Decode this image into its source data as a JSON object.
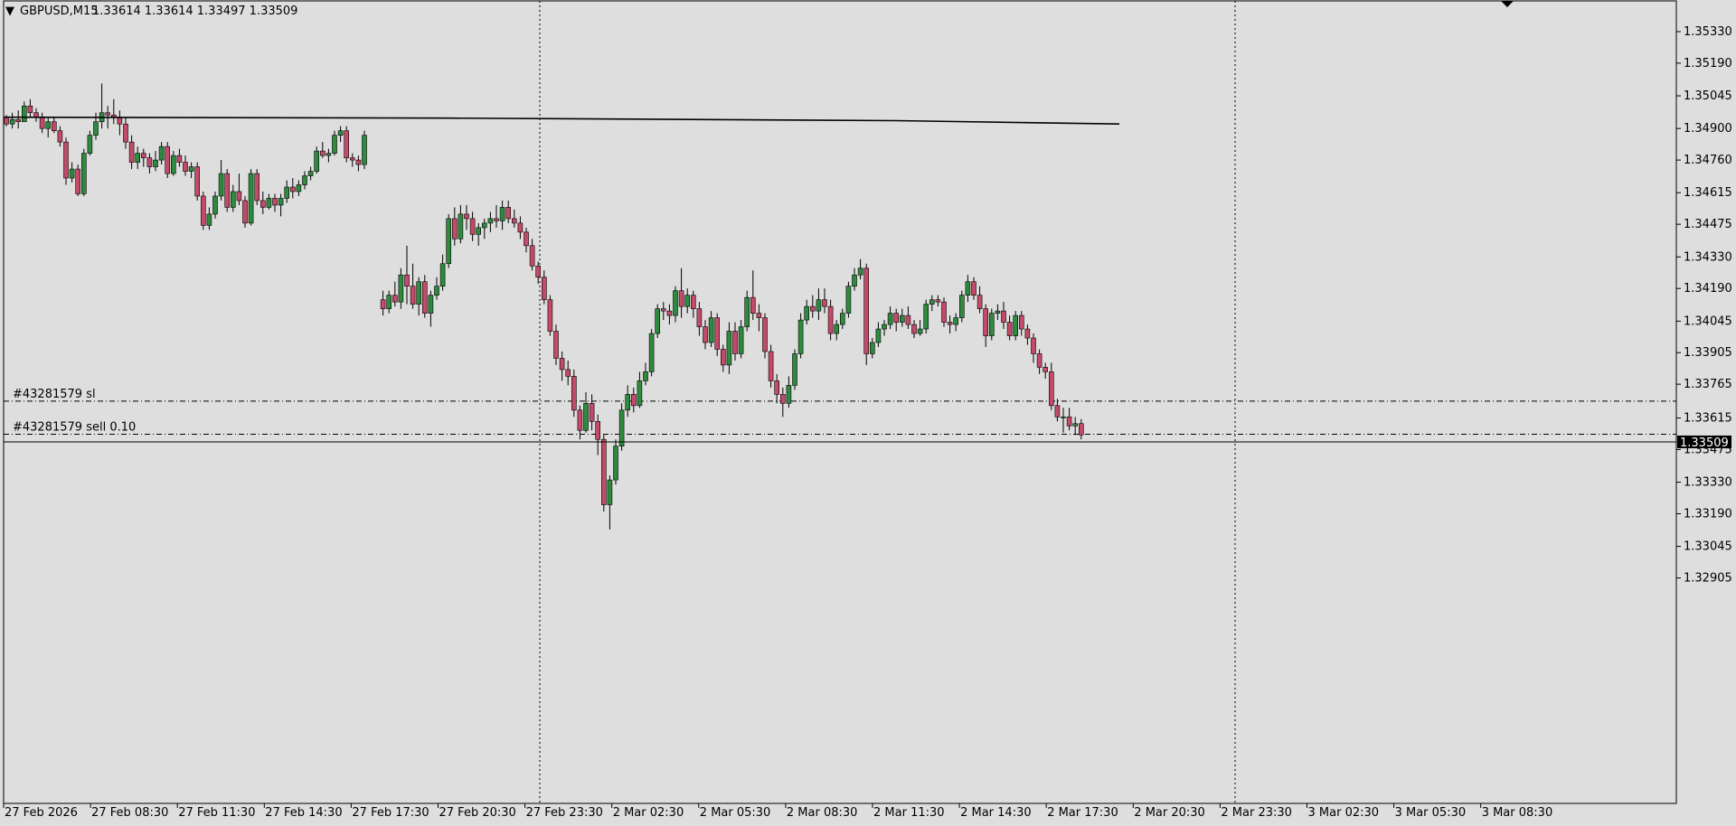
{
  "header": {
    "triangle": "▼",
    "symbol": "GBPUSD,M15",
    "ohlc": "1.33614 1.33614 1.33497 1.33509"
  },
  "price_tag": "1.33509",
  "colors": {
    "background": "#dedede",
    "bull": "#2e8b3e",
    "bear": "#c44a6a",
    "wick": "#000000",
    "price_tag_bg": "#000000",
    "price_tag_text": "#ffffff"
  },
  "order_lines": {
    "sl_label": "#43281579 sl",
    "sl_price": 1.3369,
    "sell_label": "#43281579 sell 0.10",
    "sell_price": 1.33543
  },
  "chart_data": {
    "type": "candlestick",
    "title": "GBPUSD,M15",
    "y_axis_position": "right",
    "ylim": [
      1.3286,
      1.3545
    ],
    "y_ticks": [
      "1.35330",
      "1.35190",
      "1.35045",
      "1.34900",
      "1.34760",
      "1.34615",
      "1.34475",
      "1.34330",
      "1.34190",
      "1.34045",
      "1.33905",
      "1.33765",
      "1.33615",
      "1.33475",
      "1.33330",
      "1.33190",
      "1.33045",
      "1.32905"
    ],
    "x_ticks": [
      "27 Feb 2026",
      "27 Feb 08:30",
      "27 Feb 11:30",
      "27 Feb 14:30",
      "27 Feb 17:30",
      "27 Feb 20:30",
      "27 Feb 23:30",
      "2 Mar 02:30",
      "2 Mar 05:30",
      "2 Mar 08:30",
      "2 Mar 11:30",
      "2 Mar 14:30",
      "2 Mar 17:30",
      "2 Mar 20:30",
      "2 Mar 23:30",
      "3 Mar 02:30",
      "3 Mar 05:30",
      "3 Mar 08:30"
    ],
    "grid": false,
    "period_separators": [
      "27 Feb 23:30",
      "2 Mar 23:30"
    ],
    "current_price": 1.33509,
    "moving_average": [
      {
        "x": 0,
        "y": 1.3495
      },
      {
        "x": 80,
        "y": 1.34946
      },
      {
        "x": 160,
        "y": 1.34935
      },
      {
        "x": 200,
        "y": 1.3492
      }
    ],
    "candles": [
      [
        1.3495,
        1.3496,
        1.3491,
        1.3492
      ],
      [
        1.3492,
        1.3497,
        1.349,
        1.3494
      ],
      [
        1.3494,
        1.3498,
        1.349,
        1.3493
      ],
      [
        1.3493,
        1.3502,
        1.3493,
        1.35
      ],
      [
        1.35,
        1.3503,
        1.3495,
        1.3497
      ],
      [
        1.3497,
        1.3499,
        1.3493,
        1.3495
      ],
      [
        1.3495,
        1.3497,
        1.3488,
        1.349
      ],
      [
        1.349,
        1.3495,
        1.3486,
        1.3493
      ],
      [
        1.3493,
        1.3495,
        1.3488,
        1.3489
      ],
      [
        1.3489,
        1.3491,
        1.3482,
        1.3484
      ],
      [
        1.3484,
        1.3486,
        1.3465,
        1.3468
      ],
      [
        1.3468,
        1.3475,
        1.3466,
        1.3472
      ],
      [
        1.3472,
        1.3474,
        1.346,
        1.3461
      ],
      [
        1.3461,
        1.3481,
        1.346,
        1.3479
      ],
      [
        1.3479,
        1.3489,
        1.3478,
        1.3487
      ],
      [
        1.3487,
        1.3497,
        1.3485,
        1.3493
      ],
      [
        1.3493,
        1.351,
        1.349,
        1.3497
      ],
      [
        1.3497,
        1.35,
        1.349,
        1.3496
      ],
      [
        1.3496,
        1.3503,
        1.3492,
        1.3495
      ],
      [
        1.3495,
        1.3498,
        1.3487,
        1.3492
      ],
      [
        1.3492,
        1.3495,
        1.3481,
        1.3484
      ],
      [
        1.3484,
        1.3487,
        1.3472,
        1.3475
      ],
      [
        1.3475,
        1.3482,
        1.3472,
        1.3479
      ],
      [
        1.3479,
        1.3481,
        1.3473,
        1.3477
      ],
      [
        1.3477,
        1.3479,
        1.347,
        1.3473
      ],
      [
        1.3473,
        1.348,
        1.3471,
        1.3476
      ],
      [
        1.3476,
        1.3484,
        1.3474,
        1.3482
      ],
      [
        1.3482,
        1.3484,
        1.3468,
        1.347
      ],
      [
        1.347,
        1.348,
        1.3469,
        1.3478
      ],
      [
        1.3478,
        1.3481,
        1.3473,
        1.3475
      ],
      [
        1.3475,
        1.3478,
        1.3469,
        1.3471
      ],
      [
        1.3471,
        1.3475,
        1.3468,
        1.3473
      ],
      [
        1.3473,
        1.3475,
        1.3458,
        1.346
      ],
      [
        1.346,
        1.3462,
        1.3445,
        1.3447
      ],
      [
        1.3447,
        1.3455,
        1.3445,
        1.3452
      ],
      [
        1.3452,
        1.3462,
        1.345,
        1.346
      ],
      [
        1.346,
        1.3476,
        1.3458,
        1.347
      ],
      [
        1.347,
        1.3472,
        1.3453,
        1.3455
      ],
      [
        1.3455,
        1.3465,
        1.3453,
        1.3462
      ],
      [
        1.3462,
        1.347,
        1.3456,
        1.3458
      ],
      [
        1.3458,
        1.346,
        1.3446,
        1.3448
      ],
      [
        1.3448,
        1.3472,
        1.3447,
        1.347
      ],
      [
        1.347,
        1.3472,
        1.3456,
        1.3458
      ],
      [
        1.3458,
        1.3462,
        1.3452,
        1.3455
      ],
      [
        1.3455,
        1.3461,
        1.3454,
        1.3459
      ],
      [
        1.3459,
        1.3461,
        1.3453,
        1.3456
      ],
      [
        1.3456,
        1.3461,
        1.3451,
        1.3459
      ],
      [
        1.3459,
        1.3467,
        1.3457,
        1.3464
      ],
      [
        1.3464,
        1.3468,
        1.3459,
        1.3462
      ],
      [
        1.3462,
        1.3467,
        1.346,
        1.3465
      ],
      [
        1.3465,
        1.3471,
        1.3463,
        1.3469
      ],
      [
        1.3469,
        1.3473,
        1.3467,
        1.3471
      ],
      [
        1.3471,
        1.3482,
        1.347,
        1.348
      ],
      [
        1.348,
        1.3484,
        1.3477,
        1.3478
      ],
      [
        1.3478,
        1.3481,
        1.3475,
        1.3479
      ],
      [
        1.3479,
        1.3489,
        1.3478,
        1.3487
      ],
      [
        1.3487,
        1.3491,
        1.3484,
        1.3489
      ],
      [
        1.3489,
        1.3491,
        1.3475,
        1.3477
      ],
      [
        1.3477,
        1.3479,
        1.3473,
        1.3476
      ],
      [
        1.3476,
        1.3478,
        1.3471,
        1.3474
      ],
      [
        1.3474,
        1.3489,
        1.3472,
        1.3487
      ],
      [
        1.3414,
        1.3418,
        1.3407,
        1.341
      ],
      [
        1.341,
        1.3418,
        1.3408,
        1.3416
      ],
      [
        1.3416,
        1.3422,
        1.3411,
        1.3413
      ],
      [
        1.3413,
        1.3428,
        1.341,
        1.3425
      ],
      [
        1.3425,
        1.3438,
        1.3412,
        1.342
      ],
      [
        1.342,
        1.343,
        1.341,
        1.3412
      ],
      [
        1.3412,
        1.3424,
        1.3407,
        1.3422
      ],
      [
        1.3422,
        1.3425,
        1.3406,
        1.3408
      ],
      [
        1.3408,
        1.3418,
        1.3402,
        1.3416
      ],
      [
        1.3416,
        1.3424,
        1.3414,
        1.342
      ],
      [
        1.342,
        1.3434,
        1.3418,
        1.343
      ],
      [
        1.343,
        1.3452,
        1.3428,
        1.345
      ],
      [
        1.345,
        1.3455,
        1.3438,
        1.3441
      ],
      [
        1.3441,
        1.3456,
        1.3439,
        1.3452
      ],
      [
        1.3452,
        1.3456,
        1.3445,
        1.345
      ],
      [
        1.345,
        1.3453,
        1.344,
        1.3443
      ],
      [
        1.3443,
        1.3448,
        1.3438,
        1.3446
      ],
      [
        1.3446,
        1.345,
        1.3441,
        1.3448
      ],
      [
        1.3448,
        1.3453,
        1.3444,
        1.345
      ],
      [
        1.345,
        1.3456,
        1.3446,
        1.3449
      ],
      [
        1.3449,
        1.3458,
        1.3445,
        1.3455
      ],
      [
        1.3455,
        1.3458,
        1.3448,
        1.345
      ],
      [
        1.345,
        1.3454,
        1.3446,
        1.3448
      ],
      [
        1.3448,
        1.3451,
        1.3441,
        1.3444
      ],
      [
        1.3444,
        1.3446,
        1.3435,
        1.3438
      ],
      [
        1.3438,
        1.3441,
        1.3427,
        1.3429
      ],
      [
        1.3429,
        1.3431,
        1.3421,
        1.3424
      ],
      [
        1.3424,
        1.3427,
        1.3412,
        1.3414
      ],
      [
        1.3414,
        1.3416,
        1.3398,
        1.34
      ],
      [
        1.34,
        1.3403,
        1.3385,
        1.3388
      ],
      [
        1.3388,
        1.3391,
        1.3378,
        1.3383
      ],
      [
        1.3383,
        1.3387,
        1.3376,
        1.338
      ],
      [
        1.338,
        1.3383,
        1.3362,
        1.3365
      ],
      [
        1.3365,
        1.3367,
        1.3352,
        1.3356
      ],
      [
        1.3356,
        1.3373,
        1.3355,
        1.3368
      ],
      [
        1.3368,
        1.3372,
        1.3356,
        1.336
      ],
      [
        1.336,
        1.3363,
        1.3345,
        1.3352
      ],
      [
        1.3352,
        1.3354,
        1.332,
        1.3323
      ],
      [
        1.3323,
        1.3336,
        1.3312,
        1.3334
      ],
      [
        1.3334,
        1.3352,
        1.3332,
        1.3349
      ],
      [
        1.3349,
        1.3368,
        1.3347,
        1.3365
      ],
      [
        1.3365,
        1.3376,
        1.3362,
        1.3372
      ],
      [
        1.3372,
        1.3375,
        1.3364,
        1.3367
      ],
      [
        1.3367,
        1.3382,
        1.3366,
        1.3378
      ],
      [
        1.3378,
        1.3386,
        1.3376,
        1.3382
      ],
      [
        1.3382,
        1.3401,
        1.338,
        1.3399
      ],
      [
        1.3399,
        1.3412,
        1.3397,
        1.341
      ],
      [
        1.341,
        1.3413,
        1.3405,
        1.3409
      ],
      [
        1.3409,
        1.3412,
        1.3403,
        1.3407
      ],
      [
        1.3407,
        1.342,
        1.3404,
        1.3418
      ],
      [
        1.3418,
        1.3428,
        1.3406,
        1.3411
      ],
      [
        1.3411,
        1.3419,
        1.3408,
        1.3416
      ],
      [
        1.3416,
        1.3418,
        1.3406,
        1.341
      ],
      [
        1.341,
        1.3413,
        1.3398,
        1.3402
      ],
      [
        1.3402,
        1.3405,
        1.3392,
        1.3395
      ],
      [
        1.3395,
        1.3409,
        1.3393,
        1.3406
      ],
      [
        1.3406,
        1.3408,
        1.3389,
        1.3392
      ],
      [
        1.3392,
        1.3394,
        1.3382,
        1.3385
      ],
      [
        1.3385,
        1.3404,
        1.3381,
        1.34
      ],
      [
        1.34,
        1.3404,
        1.3387,
        1.339
      ],
      [
        1.339,
        1.3405,
        1.3388,
        1.3402
      ],
      [
        1.3402,
        1.3418,
        1.34,
        1.3415
      ],
      [
        1.3415,
        1.3427,
        1.3405,
        1.3408
      ],
      [
        1.3408,
        1.3412,
        1.34,
        1.3406
      ],
      [
        1.3406,
        1.3408,
        1.3388,
        1.3391
      ],
      [
        1.3391,
        1.3394,
        1.3375,
        1.3378
      ],
      [
        1.3378,
        1.3381,
        1.3368,
        1.3372
      ],
      [
        1.3372,
        1.3375,
        1.3362,
        1.3368
      ],
      [
        1.3368,
        1.338,
        1.3366,
        1.3376
      ],
      [
        1.3376,
        1.3392,
        1.3374,
        1.339
      ],
      [
        1.339,
        1.3408,
        1.3388,
        1.3405
      ],
      [
        1.3405,
        1.3414,
        1.3403,
        1.3411
      ],
      [
        1.3411,
        1.3416,
        1.3406,
        1.3409
      ],
      [
        1.3409,
        1.3419,
        1.3405,
        1.3414
      ],
      [
        1.3414,
        1.3419,
        1.3408,
        1.3411
      ],
      [
        1.3411,
        1.3414,
        1.3396,
        1.3399
      ],
      [
        1.3399,
        1.3405,
        1.3396,
        1.3403
      ],
      [
        1.3403,
        1.341,
        1.3401,
        1.3408
      ],
      [
        1.3408,
        1.3422,
        1.3406,
        1.342
      ],
      [
        1.342,
        1.3428,
        1.3418,
        1.3425
      ],
      [
        1.3425,
        1.3432,
        1.3423,
        1.3428
      ],
      [
        1.3428,
        1.343,
        1.3385,
        1.339
      ],
      [
        1.339,
        1.3397,
        1.3388,
        1.3395
      ],
      [
        1.3395,
        1.3404,
        1.3393,
        1.3401
      ],
      [
        1.3401,
        1.3405,
        1.3398,
        1.3403
      ],
      [
        1.3403,
        1.3411,
        1.3401,
        1.3408
      ],
      [
        1.3408,
        1.341,
        1.34,
        1.3404
      ],
      [
        1.3404,
        1.341,
        1.3402,
        1.3407
      ],
      [
        1.3407,
        1.3411,
        1.3401,
        1.3403
      ]
    ],
    "candles_2": [
      [
        1.3403,
        1.3405,
        1.3397,
        1.3399
      ],
      [
        1.3399,
        1.3405,
        1.3398,
        1.3401
      ],
      [
        1.3401,
        1.3414,
        1.3399,
        1.3412
      ],
      [
        1.3412,
        1.3416,
        1.3409,
        1.3414
      ],
      [
        1.3414,
        1.3416,
        1.3411,
        1.3413
      ],
      [
        1.3413,
        1.3415,
        1.3402,
        1.3404
      ],
      [
        1.3404,
        1.3407,
        1.3399,
        1.3403
      ],
      [
        1.3403,
        1.3408,
        1.34,
        1.3406
      ],
      [
        1.3406,
        1.3418,
        1.3404,
        1.3416
      ],
      [
        1.3416,
        1.3425,
        1.3413,
        1.3422
      ],
      [
        1.3422,
        1.3424,
        1.3414,
        1.3416
      ],
      [
        1.3416,
        1.342,
        1.3408,
        1.341
      ],
      [
        1.341,
        1.3412,
        1.3393,
        1.3398
      ],
      [
        1.3398,
        1.341,
        1.3396,
        1.3408
      ],
      [
        1.3408,
        1.3412,
        1.3405,
        1.3409
      ],
      [
        1.3409,
        1.3413,
        1.3401,
        1.3404
      ],
      [
        1.3404,
        1.3407,
        1.3396,
        1.3398
      ],
      [
        1.3398,
        1.3409,
        1.3396,
        1.3407
      ],
      [
        1.3407,
        1.3409,
        1.3398,
        1.3401
      ],
      [
        1.3401,
        1.3403,
        1.3394,
        1.3397
      ],
      [
        1.3397,
        1.3399,
        1.3386,
        1.339
      ],
      [
        1.339,
        1.3392,
        1.3381,
        1.3384
      ],
      [
        1.3384,
        1.3386,
        1.3379,
        1.3382
      ],
      [
        1.3382,
        1.3386,
        1.3365,
        1.3367
      ],
      [
        1.3367,
        1.337,
        1.336,
        1.3362
      ],
      [
        1.3362,
        1.3366,
        1.3355,
        1.3362
      ],
      [
        1.3362,
        1.3366,
        1.3356,
        1.3358
      ],
      [
        1.3358,
        1.3362,
        1.3354,
        1.3359
      ],
      [
        1.3359,
        1.3361,
        1.3352,
        1.3354
      ]
    ]
  }
}
